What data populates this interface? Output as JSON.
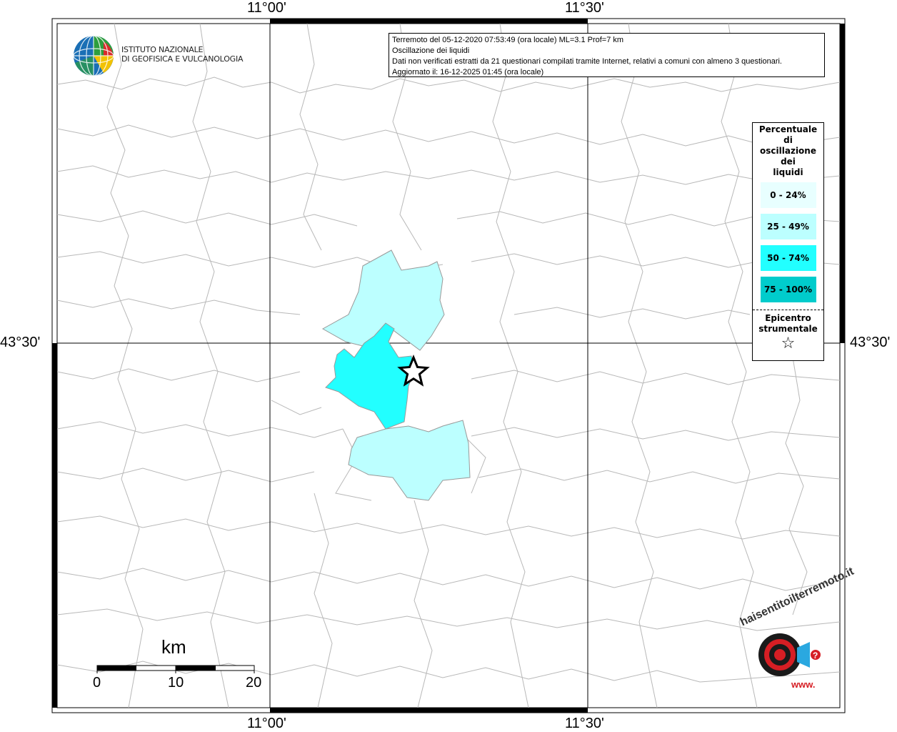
{
  "info": {
    "line1": "Terremoto del 05-12-2020 07:53:49 (ora locale) ML=3.1 Prof=7 km",
    "line2": "Oscillazione dei liquidi",
    "line3": "Dati non verificati estratti da 21 questionari compilati tramite Internet, relativi a comuni con almeno 3 questionari.",
    "line4": "Aggiornato il: 16-12-2025 01:45 (ora locale)"
  },
  "coords": {
    "top_left": "11°00'",
    "top_right": "11°30'",
    "bottom_left": "11°00'",
    "bottom_right": "11°30'",
    "left": "43°30'",
    "right": "43°30'"
  },
  "logo": {
    "ingv_line1": "ISTITUTO NAZIONALE",
    "ingv_line2": "DI GEOFISICA E VULCANOLOGIA",
    "hsit_text": "haisentitoilterremoto.it",
    "hsit_www": "www.",
    "hsit_q": "?"
  },
  "legend": {
    "title_lines": [
      "Percentuale",
      "di",
      "oscillazione",
      "dei",
      "liquidi"
    ],
    "items": [
      {
        "label": "0 - 24%",
        "color": "#e8ffff"
      },
      {
        "label": "25 - 49%",
        "color": "#bcffff"
      },
      {
        "label": "50 - 74%",
        "color": "#22ffff"
      },
      {
        "label": "75 - 100%",
        "color": "#00cccc"
      }
    ],
    "epicenter_line1": "Epicentro",
    "epicenter_line2": "strumentale",
    "star": "☆"
  },
  "scale": {
    "unit": "km",
    "labels": [
      "0",
      "10",
      "20"
    ]
  },
  "colors": {
    "region_light": "#bcffff",
    "region_strong": "#22ffff",
    "borders": "#b8b8b8"
  }
}
